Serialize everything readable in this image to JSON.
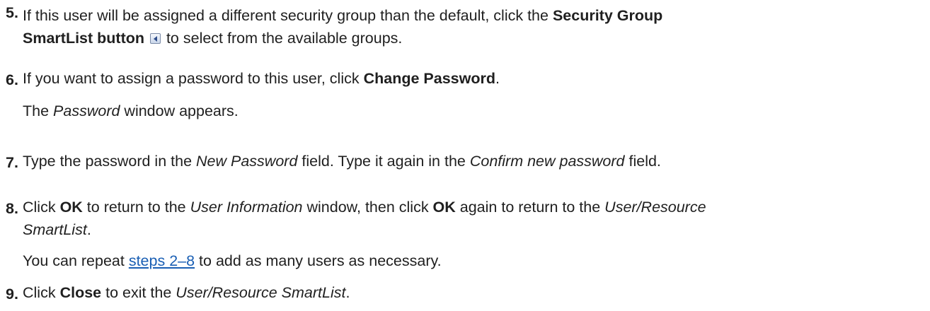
{
  "steps": [
    {
      "number": "5.",
      "line1_a": "If this user will be assigned a different security group than the default, click the ",
      "line1_b": "Security Group",
      "line2_a": "SmartList button",
      "line2_b": " to select from the available groups.",
      "icon": "smartlist-button-icon"
    },
    {
      "number": "6.",
      "text_a": "If you want to assign a password to this user, click ",
      "text_b": "Change Password",
      "text_c": ".",
      "note_a": "The ",
      "note_b": "Password",
      "note_c": " window appears."
    },
    {
      "number": "7.",
      "text_a": "Type the password in the ",
      "text_b": "New Password",
      "text_c": " field. Type it again in the ",
      "text_d": "Confirm new password",
      "text_e": " field."
    },
    {
      "number": "8.",
      "line1_a": "Click ",
      "line1_b": "OK",
      "line1_c": " to return to the ",
      "line1_d": "User Information",
      "line1_e": " window, then click ",
      "line1_f": "OK",
      "line1_g": " again to return to the ",
      "line1_h": "User/Resource",
      "line2_a": "SmartList",
      "line2_b": ".",
      "note_a": "You can repeat ",
      "note_link": "steps 2–8",
      "note_c": " to add as many users as necessary."
    },
    {
      "number": "9.",
      "text_a": "Click ",
      "text_b": "Close",
      "text_c": " to exit the ",
      "text_d": "User/Resource SmartList",
      "text_e": "."
    }
  ]
}
